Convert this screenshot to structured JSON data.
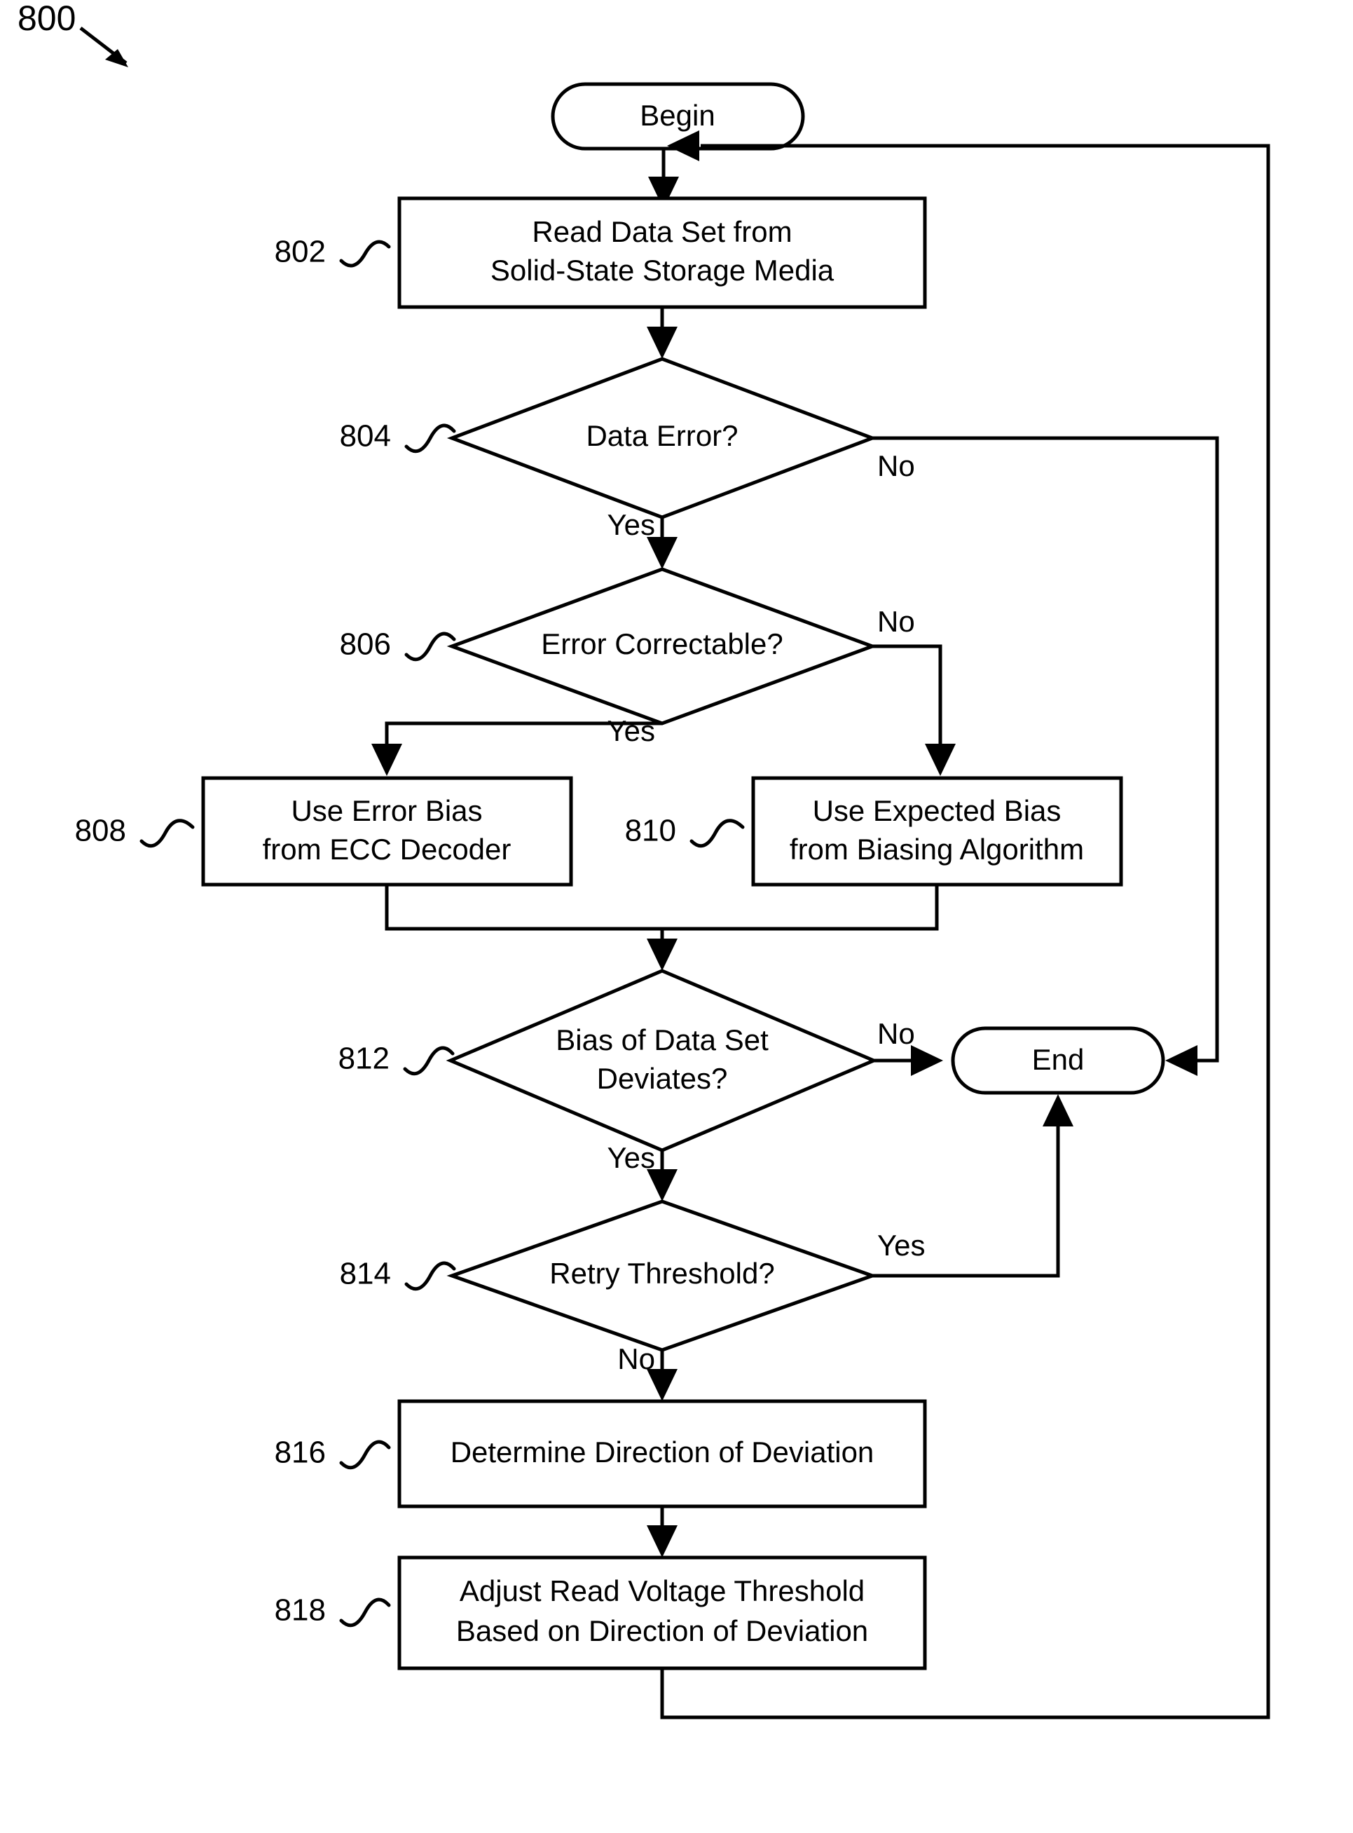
{
  "figure": {
    "reference_numeral": "800",
    "type": "flowchart"
  },
  "terminals": {
    "begin": {
      "label": "Begin"
    },
    "end": {
      "label": "End"
    }
  },
  "steps": [
    {
      "ref": "802",
      "shape": "process",
      "line1": "Read Data Set from",
      "line2": "Solid-State Storage Media"
    },
    {
      "ref": "804",
      "shape": "decision",
      "line1": "Data Error?",
      "line2": ""
    },
    {
      "ref": "806",
      "shape": "decision",
      "line1": "Error Correctable?",
      "line2": ""
    },
    {
      "ref": "808",
      "shape": "process",
      "line1": "Use Error Bias",
      "line2": "from ECC Decoder"
    },
    {
      "ref": "810",
      "shape": "process",
      "line1": "Use Expected Bias",
      "line2": "from Biasing Algorithm"
    },
    {
      "ref": "812",
      "shape": "decision",
      "line1": "Bias of Data Set",
      "line2": "Deviates?"
    },
    {
      "ref": "814",
      "shape": "decision",
      "line1": "Retry Threshold?",
      "line2": ""
    },
    {
      "ref": "816",
      "shape": "process",
      "line1": "Determine Direction of Deviation",
      "line2": ""
    },
    {
      "ref": "818",
      "shape": "process",
      "line1": "Adjust Read Voltage Threshold",
      "line2": "Based on Direction of Deviation"
    }
  ],
  "branch_labels": {
    "d804_yes": "Yes",
    "d804_no": "No",
    "d806_yes": "Yes",
    "d806_no": "No",
    "d812_yes": "Yes",
    "d812_no": "No",
    "d814_yes": "Yes",
    "d814_no": "No"
  },
  "colors": {
    "stroke": "#000000",
    "fill": "#ffffff",
    "background": "#ffffff"
  }
}
